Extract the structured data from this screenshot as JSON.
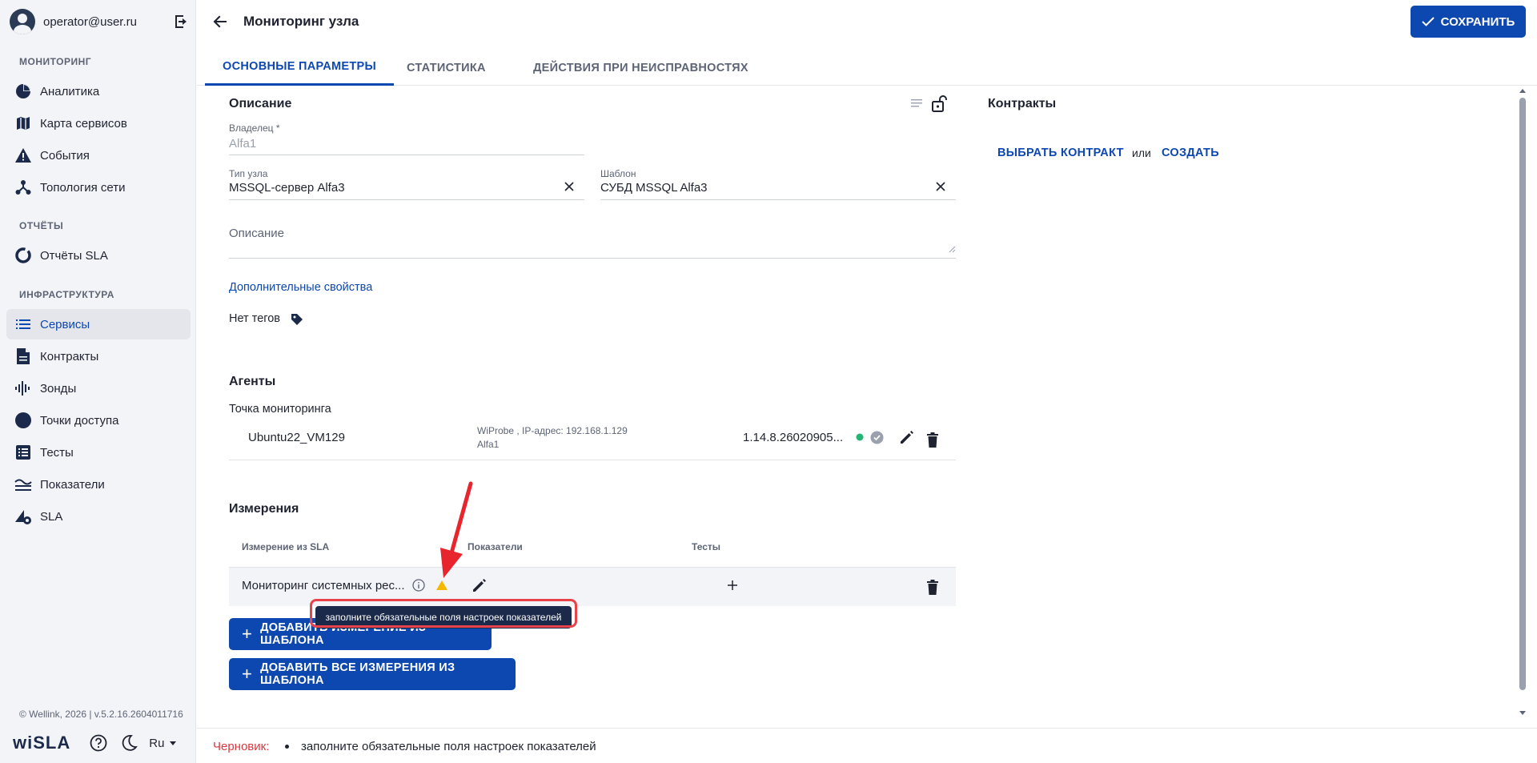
{
  "user": {
    "email": "operator@user.ru"
  },
  "sidebar": {
    "sections": [
      {
        "title": "МОНИТОРИНГ"
      },
      {
        "title": "ОТЧЁТЫ"
      },
      {
        "title": "ИНФРАСТРУКТУРА"
      }
    ],
    "items": [
      {
        "label": "Аналитика"
      },
      {
        "label": "Карта сервисов"
      },
      {
        "label": "События"
      },
      {
        "label": "Топология сети"
      },
      {
        "label": "Отчёты SLA"
      },
      {
        "label": "Сервисы",
        "active": true
      },
      {
        "label": "Контракты"
      },
      {
        "label": "Зонды"
      },
      {
        "label": "Точки доступа"
      },
      {
        "label": "Тесты"
      },
      {
        "label": "Показатели"
      },
      {
        "label": "SLA"
      }
    ],
    "copyright": "© Wellink, 2026 | v.5.2.16.2604011716",
    "brand": "wiSLA",
    "lang": "Ru"
  },
  "header": {
    "title": "Мониторинг узла",
    "save_label": "СОХРАНИТЬ"
  },
  "tabs": [
    {
      "label": "ОСНОВНЫЕ ПАРАМЕТРЫ",
      "active": true
    },
    {
      "label": "СТАТИСТИКА"
    },
    {
      "label": "ДЕЙСТВИЯ ПРИ НЕИСПРАВНОСТЯХ"
    }
  ],
  "description": {
    "title": "Описание",
    "owner_label": "Владелец *",
    "owner_value": "Alfa1",
    "node_type_label": "Тип узла",
    "node_type_value": "MSSQL-сервер Alfa3",
    "template_label": "Шаблон",
    "template_value": "СУБД MSSQL Alfa3",
    "desc_placeholder": "Описание",
    "extra_props": "Дополнительные свойства",
    "no_tags": "Нет тегов"
  },
  "contracts": {
    "title": "Контракты",
    "choose": "ВЫБРАТЬ КОНТРАКТ",
    "or": "или",
    "create": "СОЗДАТЬ"
  },
  "agents": {
    "title": "Агенты",
    "point_label": "Точка мониторинга",
    "row": {
      "name": "Ubuntu22_VM129",
      "info_line1": "WiProbe , IP-адрес: 192.168.1.129",
      "info_line2": "Alfa1",
      "version": "1.14.8.26020905..."
    }
  },
  "measurements": {
    "title": "Измерения",
    "columns": [
      "Измерение из SLA",
      "Показатели",
      "Тесты"
    ],
    "row_name": "Мониторинг системных рес...",
    "tooltip": "заполните обязательные поля настроек показателей",
    "add_from_template": "ДОБАВИТЬ ИЗМЕРЕНИЕ ИЗ ШАБЛОНА",
    "add_all_from_template": "ДОБАВИТЬ ВСЕ ИЗМЕРЕНИЯ ИЗ ШАБЛОНА"
  },
  "footer": {
    "draft_label": "Черновик:",
    "draft_message": "заполните обязательные поля настроек показателей"
  },
  "colors": {
    "accent": "#0d47b0",
    "warning": "#f5b800",
    "success": "#22b573",
    "error": "#d8393f"
  }
}
